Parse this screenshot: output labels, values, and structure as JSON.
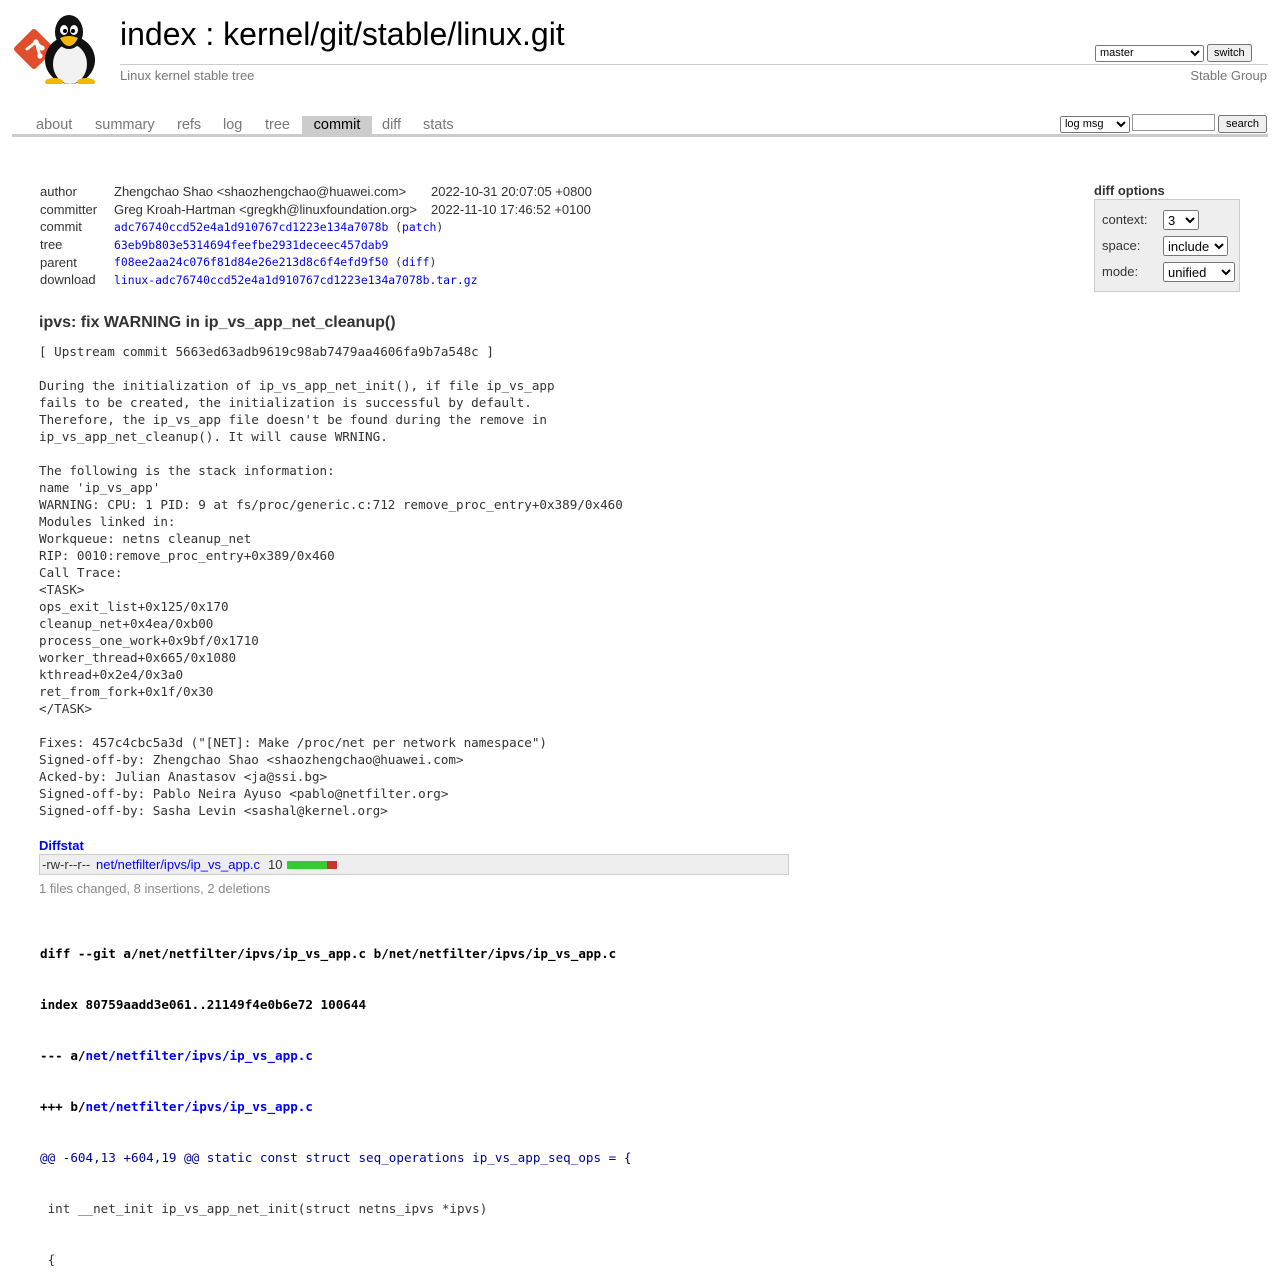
{
  "header": {
    "index_label": "index",
    "separator": " : ",
    "repo_path": "kernel/git/stable/linux.git",
    "description": "Linux kernel stable tree",
    "branch_selected": "master",
    "switch_label": "switch",
    "owner": "Stable Group"
  },
  "tabs": [
    {
      "label": "about"
    },
    {
      "label": "summary"
    },
    {
      "label": "refs"
    },
    {
      "label": "log"
    },
    {
      "label": "tree"
    },
    {
      "label": "commit",
      "active": true
    },
    {
      "label": "diff"
    },
    {
      "label": "stats"
    }
  ],
  "search": {
    "type_selected": "log msg",
    "query": "",
    "button_label": "search"
  },
  "commit": {
    "author_label": "author",
    "author_name": "Zhengchao Shao <shaozhengchao@huawei.com>",
    "author_date": "2022-10-31 20:07:05 +0800",
    "committer_label": "committer",
    "committer_name": "Greg Kroah-Hartman <gregkh@linuxfoundation.org>",
    "committer_date": "2022-11-10 17:46:52 +0100",
    "commit_label": "commit",
    "commit_hash": "adc76740ccd52e4a1d910767cd1223e134a7078b",
    "patch_link": "patch",
    "tree_label": "tree",
    "tree_hash": "63eb9b803e5314694feefbe2931deceec457dab9",
    "parent_label": "parent",
    "parent_hash": "f08ee2aa24c076f81d84e26e213d8c6f4efd9f50",
    "diff_link": "diff",
    "download_label": "download",
    "download_file": "linux-adc76740ccd52e4a1d910767cd1223e134a7078b.tar.gz",
    "subject": "ipvs: fix WARNING in ip_vs_app_net_cleanup()",
    "message": "[ Upstream commit 5663ed63adb9619c98ab7479aa4606fa9b7a548c ]\n\nDuring the initialization of ip_vs_app_net_init(), if file ip_vs_app\nfails to be created, the initialization is successful by default.\nTherefore, the ip_vs_app file doesn't be found during the remove in\nip_vs_app_net_cleanup(). It will cause WRNING.\n\nThe following is the stack information:\nname 'ip_vs_app'\nWARNING: CPU: 1 PID: 9 at fs/proc/generic.c:712 remove_proc_entry+0x389/0x460\nModules linked in:\nWorkqueue: netns cleanup_net\nRIP: 0010:remove_proc_entry+0x389/0x460\nCall Trace:\n<TASK>\nops_exit_list+0x125/0x170\ncleanup_net+0x4ea/0xb00\nprocess_one_work+0x9bf/0x1710\nworker_thread+0x665/0x1080\nkthread+0x2e4/0x3a0\nret_from_fork+0x1f/0x30\n</TASK>\n\nFixes: 457c4cbc5a3d (\"[NET]: Make /proc/net per network namespace\")\nSigned-off-by: Zhengchao Shao <shaozhengchao@huawei.com>\nAcked-by: Julian Anastasov <ja@ssi.bg>\nSigned-off-by: Pablo Neira Ayuso <pablo@netfilter.org>\nSigned-off-by: Sasha Levin <sashal@kernel.org>"
  },
  "diff_options": {
    "title": "diff options",
    "context_label": "context:",
    "context_value": "3",
    "space_label": "space:",
    "space_value": "include",
    "mode_label": "mode:",
    "mode_value": "unified"
  },
  "diffstat": {
    "title": "Diffstat",
    "mode": "-rw-r--r--",
    "file": "net/netfilter/ipvs/ip_vs_app.c",
    "count": "10",
    "insertions": 8,
    "deletions": 2,
    "summary": "1 files changed, 8 insertions, 2 deletions"
  },
  "diff": {
    "git_line": "diff --git a/net/netfilter/ipvs/ip_vs_app.c b/net/netfilter/ipvs/ip_vs_app.c",
    "index_line": "index 80759aadd3e061..21149f4e0b6e72 100644",
    "minus_prefix": "--- a/",
    "plus_prefix": "+++ b/",
    "file_path": "net/netfilter/ipvs/ip_vs_app.c",
    "hunk_line": "@@ -604,13 +604,19 @@ static const struct seq_operations ip_vs_app_seq_ops = {",
    "context_line_1": " int __net_init ip_vs_app_net_init(struct netns_ipvs *ipvs)",
    "context_line_2": " {"
  },
  "colors": {
    "link": "#0000ff",
    "active_tab_bg": "#cccccc",
    "graph_add": "#33cc33",
    "graph_del": "#cc3333",
    "hunk": "#000099"
  }
}
